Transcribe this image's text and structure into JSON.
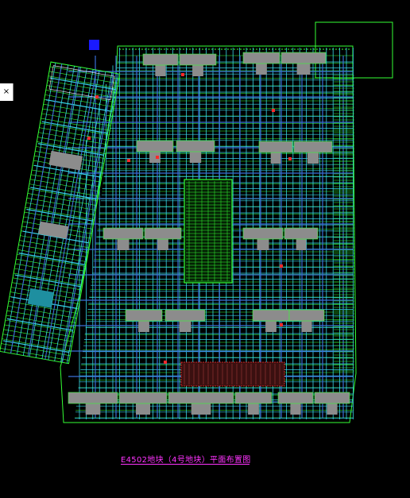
{
  "viewer": {
    "close_label": "×",
    "drawing_title": "E4502地块（4号地块）平面布置图"
  },
  "colors": {
    "background": "#000000",
    "grid_cyan": "#36d6e6",
    "grid_blue": "#3a6fd8",
    "grid_green": "#33ff33",
    "building_gray": "#8c8c8c",
    "title_magenta": "#ff33ff",
    "marker_red": "#ff2a2a",
    "marker_blue": "#1a1aff"
  },
  "icons": {
    "close": "close-icon",
    "ucs": "ucs-marker-icon"
  }
}
